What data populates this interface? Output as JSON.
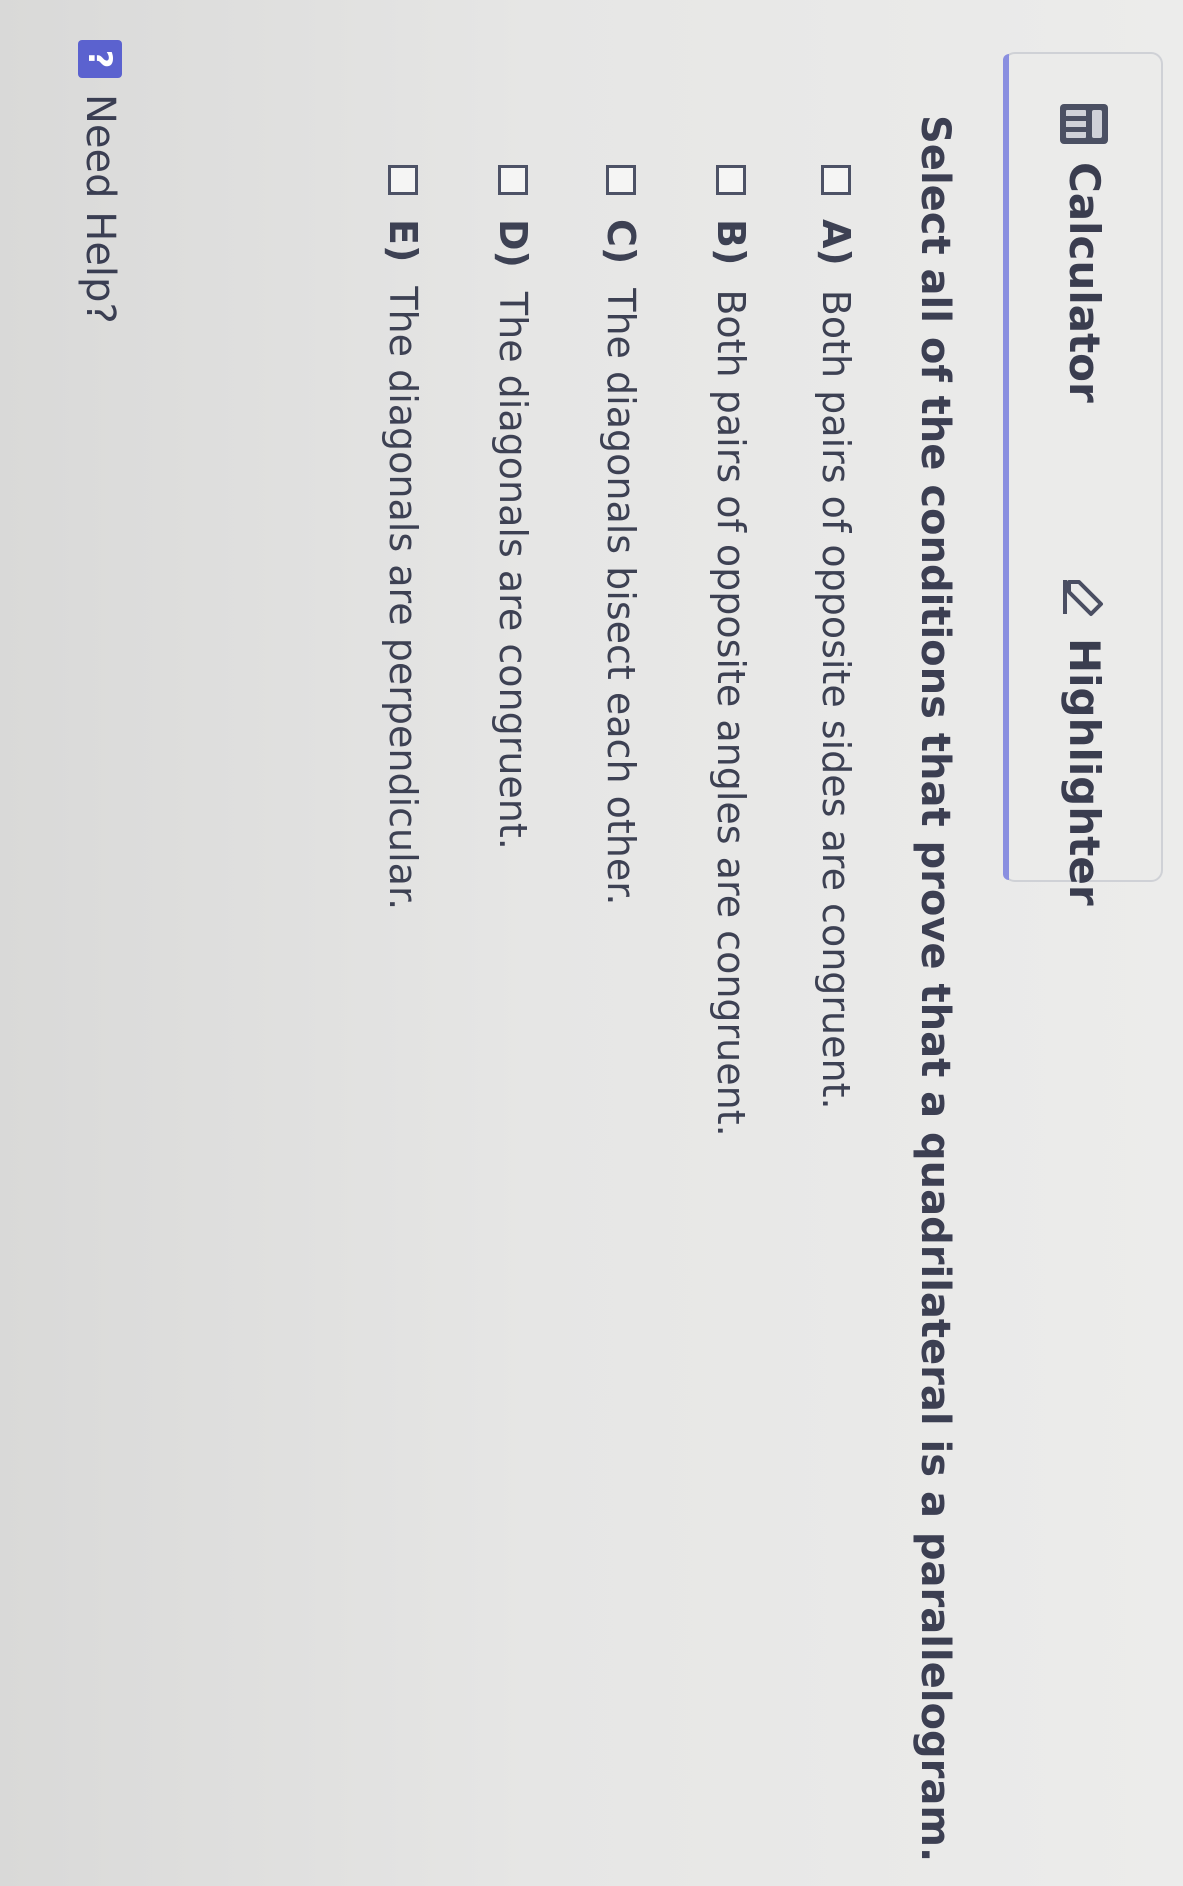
{
  "toolbar": {
    "calculator_label": "Calculator",
    "highlighter_label": "Highlighter",
    "accent": "#8a8fe0"
  },
  "question": {
    "prompt": "Select all of the conditions that prove that a quadrilateral is a parallelogram.",
    "options": [
      {
        "letter": "A)",
        "text": "Both pairs of opposite sides are congruent.",
        "checked": false
      },
      {
        "letter": "B)",
        "text": "Both pairs of opposite angles are congruent.",
        "checked": false
      },
      {
        "letter": "C)",
        "text": "The diagonals bisect each other.",
        "checked": false
      },
      {
        "letter": "D)",
        "text": "The diagonals are congruent.",
        "checked": false
      },
      {
        "letter": "E)",
        "text": "The diagonals are perpendicular.",
        "checked": false
      }
    ]
  },
  "help": {
    "icon": "?",
    "label": "Need Help?",
    "badge_color": "#5b62cf"
  },
  "icons": {
    "calculator": "calculator-icon",
    "highlighter": "highlighter-pen-icon",
    "help": "question-mark-icon"
  }
}
